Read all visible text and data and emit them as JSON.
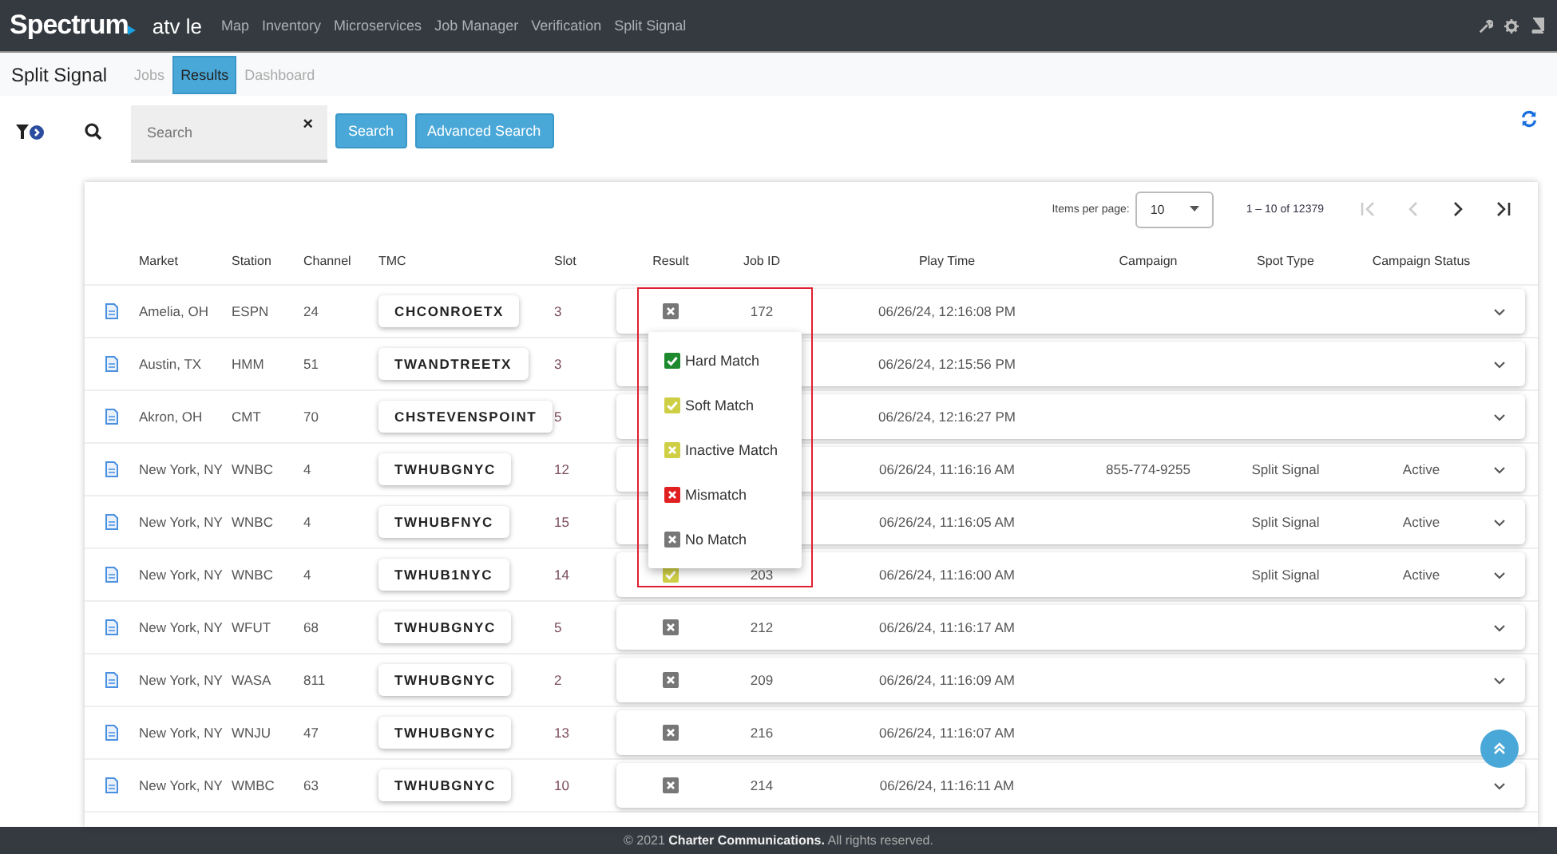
{
  "topbar": {
    "logo": "Spectrum",
    "app": "atv le",
    "links": [
      "Map",
      "Inventory",
      "Microservices",
      "Job Manager",
      "Verification",
      "Split Signal"
    ]
  },
  "subnav": {
    "title": "Split Signal",
    "tabs": [
      {
        "label": "Jobs",
        "selected": false
      },
      {
        "label": "Results",
        "selected": true
      },
      {
        "label": "Dashboard",
        "selected": false
      }
    ]
  },
  "search": {
    "placeholder": "Search",
    "clear": "×",
    "buttons": [
      "Search",
      "Advanced Search"
    ]
  },
  "pagination": {
    "label": "Items per page:",
    "page_size": "10",
    "range": "1 – 10 of 12379"
  },
  "table": {
    "columns": [
      "Market",
      "Station",
      "Channel",
      "TMC",
      "Slot",
      "Result",
      "Job ID",
      "Play Time",
      "Campaign",
      "Spot Type",
      "Campaign Status"
    ],
    "rows": [
      {
        "market": "Amelia, OH",
        "station": "ESPN",
        "channel": "24",
        "tmc": "CHCONROETX",
        "slot": "3",
        "result": {
          "kind": "none"
        },
        "job_id": "172",
        "play_time": "06/26/24, 12:16:08 PM"
      },
      {
        "market": "Austin, TX",
        "station": "HMM",
        "channel": "51",
        "tmc": "TWANDTREETX",
        "slot": "3",
        "play_time": "06/26/24, 12:15:56 PM"
      },
      {
        "market": "Akron, OH",
        "station": "CMT",
        "channel": "70",
        "tmc": "CHSTEVENSPOINT",
        "slot": "5",
        "play_time": "06/26/24, 12:16:27 PM"
      },
      {
        "market": "New York, NY",
        "station": "WNBC",
        "channel": "4",
        "tmc": "TWHUBGNYC",
        "slot": "12",
        "play_time": "06/26/24, 11:16:16 AM",
        "campaign": "855-774-9255",
        "spot_type": "Split Signal",
        "status": "Active"
      },
      {
        "market": "New York, NY",
        "station": "WNBC",
        "channel": "4",
        "tmc": "TWHUBFNYC",
        "slot": "15",
        "play_time": "06/26/24, 11:16:05 AM",
        "spot_type": "Split Signal",
        "status": "Active"
      },
      {
        "market": "New York, NY",
        "station": "WNBC",
        "channel": "4",
        "tmc": "TWHUB1NYC",
        "slot": "14",
        "result": {
          "kind": "soft"
        },
        "job_id": "203",
        "play_time": "06/26/24, 11:16:00 AM",
        "spot_type": "Split Signal",
        "status": "Active"
      },
      {
        "market": "New York, NY",
        "station": "WFUT",
        "channel": "68",
        "tmc": "TWHUBGNYC",
        "slot": "5",
        "result": {
          "kind": "none"
        },
        "job_id": "212",
        "play_time": "06/26/24, 11:16:17 AM"
      },
      {
        "market": "New York, NY",
        "station": "WASA",
        "channel": "811",
        "tmc": "TWHUBGNYC",
        "slot": "2",
        "result": {
          "kind": "none"
        },
        "job_id": "209",
        "play_time": "06/26/24, 11:16:09 AM"
      },
      {
        "market": "New York, NY",
        "station": "WNJU",
        "channel": "47",
        "tmc": "TWHUBGNYC",
        "slot": "13",
        "result": {
          "kind": "none"
        },
        "job_id": "216",
        "play_time": "06/26/24, 11:16:07 AM"
      },
      {
        "market": "New York, NY",
        "station": "WMBC",
        "channel": "63",
        "tmc": "TWHUBGNYC",
        "slot": "10",
        "result": {
          "kind": "none"
        },
        "job_id": "214",
        "play_time": "06/26/24, 11:16:11 AM"
      }
    ]
  },
  "result_menu": {
    "open": true,
    "highlighted": true,
    "items": [
      {
        "kind": "hard",
        "label": "Hard Match"
      },
      {
        "kind": "soft",
        "label": "Soft Match"
      },
      {
        "kind": "inactive",
        "label": "Inactive Match"
      },
      {
        "kind": "mismatch",
        "label": "Mismatch"
      },
      {
        "kind": "none",
        "label": "No Match"
      }
    ]
  },
  "footer": "© 2021 **Charter Communications.** All rights reserved."
}
